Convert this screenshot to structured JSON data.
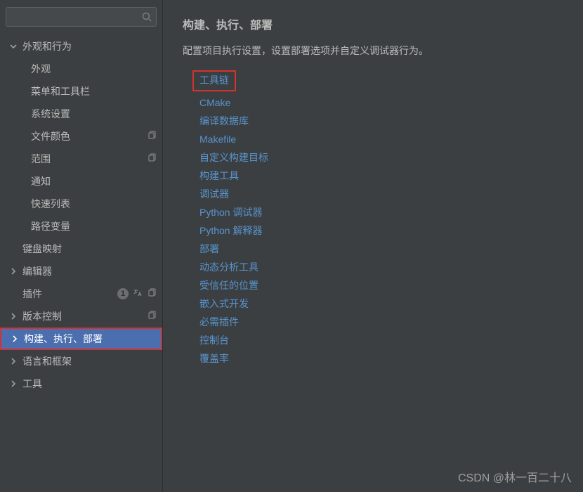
{
  "search": {
    "placeholder": ""
  },
  "sidebar": {
    "items": [
      {
        "label": "外观和行为",
        "level": 0,
        "chevron": "down"
      },
      {
        "label": "外观",
        "level": 1
      },
      {
        "label": "菜单和工具栏",
        "level": 1
      },
      {
        "label": "系统设置",
        "level": 1,
        "chevron": "right"
      },
      {
        "label": "文件颜色",
        "level": 1,
        "copy": true
      },
      {
        "label": "范围",
        "level": 1,
        "copy": true
      },
      {
        "label": "通知",
        "level": 1
      },
      {
        "label": "快速列表",
        "level": 1
      },
      {
        "label": "路径变量",
        "level": 1
      },
      {
        "label": "键盘映射",
        "level": 0
      },
      {
        "label": "编辑器",
        "level": 0,
        "chevron": "right"
      },
      {
        "label": "插件",
        "level": 0,
        "badge": "1",
        "lang": true,
        "copy": true
      },
      {
        "label": "版本控制",
        "level": 0,
        "chevron": "right",
        "copy": true
      },
      {
        "label": "构建、执行、部署",
        "level": 0,
        "chevron": "right",
        "selected": true
      },
      {
        "label": "语言和框架",
        "level": 0,
        "chevron": "right"
      },
      {
        "label": "工具",
        "level": 0,
        "chevron": "right"
      }
    ]
  },
  "main": {
    "title": "构建、执行、部署",
    "desc": "配置项目执行设置，设置部署选项并自定义调试器行为。",
    "links": [
      {
        "label": "工具链",
        "highlighted": true
      },
      {
        "label": "CMake"
      },
      {
        "label": "编译数据库"
      },
      {
        "label": "Makefile"
      },
      {
        "label": "自定义构建目标"
      },
      {
        "label": "构建工具"
      },
      {
        "label": "调试器"
      },
      {
        "label": "Python 调试器"
      },
      {
        "label": "Python 解释器"
      },
      {
        "label": "部署"
      },
      {
        "label": "动态分析工具"
      },
      {
        "label": "受信任的位置"
      },
      {
        "label": "嵌入式开发"
      },
      {
        "label": "必需插件"
      },
      {
        "label": "控制台"
      },
      {
        "label": "覆盖率"
      }
    ]
  },
  "watermark": "CSDN @林一百二十八"
}
